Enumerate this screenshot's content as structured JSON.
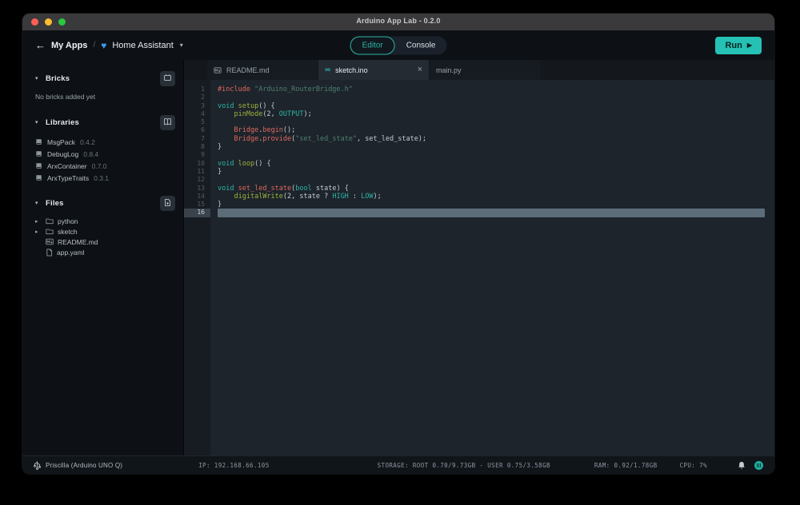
{
  "window": {
    "title": "Arduino App Lab - 0.2.0"
  },
  "nav": {
    "back": "My Apps",
    "breadcrumb_separator": "/",
    "app_name": "Home Assistant",
    "toggle": {
      "editor": "Editor",
      "console": "Console",
      "active": "Editor"
    },
    "run": "Run"
  },
  "sidebar": {
    "bricks": {
      "title": "Bricks",
      "empty_message": "No bricks added yet"
    },
    "libraries": {
      "title": "Libraries",
      "items": [
        {
          "name": "MsgPack",
          "version": "0.4.2"
        },
        {
          "name": "DebugLog",
          "version": "0.8.4"
        },
        {
          "name": "ArxContainer",
          "version": "0.7.0"
        },
        {
          "name": "ArxTypeTraits",
          "version": "0.3.1"
        }
      ]
    },
    "files": {
      "title": "Files",
      "items": [
        {
          "name": "python",
          "type": "folder"
        },
        {
          "name": "sketch",
          "type": "folder"
        },
        {
          "name": "README.md",
          "type": "markdown"
        },
        {
          "name": "app.yaml",
          "type": "yaml"
        }
      ]
    }
  },
  "editor": {
    "tabs": [
      {
        "label": "README.md",
        "icon": "markdown",
        "active": false,
        "closable": false
      },
      {
        "label": "sketch.ino",
        "icon": "ino",
        "active": true,
        "closable": true
      },
      {
        "label": "main.py",
        "icon": null,
        "active": false,
        "closable": false
      }
    ],
    "active_line": 16,
    "lines": [
      [
        [
          "orange",
          "#include"
        ],
        [
          "plain",
          " "
        ],
        [
          "string",
          "\"Arduino_RouterBridge.h\""
        ]
      ],
      [],
      [
        [
          "teal",
          "void"
        ],
        [
          "plain",
          " "
        ],
        [
          "green",
          "setup"
        ],
        [
          "plain",
          "() {"
        ]
      ],
      [
        [
          "plain",
          "    "
        ],
        [
          "green",
          "pinMode"
        ],
        [
          "plain",
          "(2, "
        ],
        [
          "teal",
          "OUTPUT"
        ],
        [
          "plain",
          ");"
        ]
      ],
      [],
      [
        [
          "plain",
          "    "
        ],
        [
          "orange",
          "Bridge"
        ],
        [
          "plain",
          "."
        ],
        [
          "orange",
          "begin"
        ],
        [
          "plain",
          "();"
        ]
      ],
      [
        [
          "plain",
          "    "
        ],
        [
          "orange",
          "Bridge"
        ],
        [
          "plain",
          "."
        ],
        [
          "orange",
          "provide"
        ],
        [
          "plain",
          "("
        ],
        [
          "string",
          "\"set_led_state\""
        ],
        [
          "plain",
          ", set_led_state);"
        ]
      ],
      [
        [
          "plain",
          "}"
        ]
      ],
      [],
      [
        [
          "teal",
          "void"
        ],
        [
          "plain",
          " "
        ],
        [
          "green",
          "loop"
        ],
        [
          "plain",
          "() {"
        ]
      ],
      [
        [
          "plain",
          "}"
        ]
      ],
      [],
      [
        [
          "teal",
          "void"
        ],
        [
          "plain",
          " "
        ],
        [
          "orange",
          "set_led_state"
        ],
        [
          "plain",
          "("
        ],
        [
          "teal",
          "bool"
        ],
        [
          "plain",
          " state) {"
        ]
      ],
      [
        [
          "plain",
          "    "
        ],
        [
          "green",
          "digitalWrite"
        ],
        [
          "plain",
          "(2, state ? "
        ],
        [
          "teal",
          "HIGH"
        ],
        [
          "plain",
          " : "
        ],
        [
          "teal",
          "LOW"
        ],
        [
          "plain",
          ");"
        ]
      ],
      [
        [
          "plain",
          "}"
        ]
      ],
      []
    ]
  },
  "statusbar": {
    "device": "Priscilla (Arduino UNO Q)",
    "ip": "IP: 192.168.66.105",
    "storage": "STORAGE: ROOT 0.70/9.73GB - USER 0.75/3.58GB",
    "ram": "RAM: 0.92/1.78GB",
    "cpu": "CPU: 7%"
  },
  "colors": {
    "accent": "#25c1b4",
    "heart": "#3d9cf0",
    "traffic_red": "#ff5f57",
    "traffic_yellow": "#febc2e",
    "traffic_green": "#28c840"
  }
}
